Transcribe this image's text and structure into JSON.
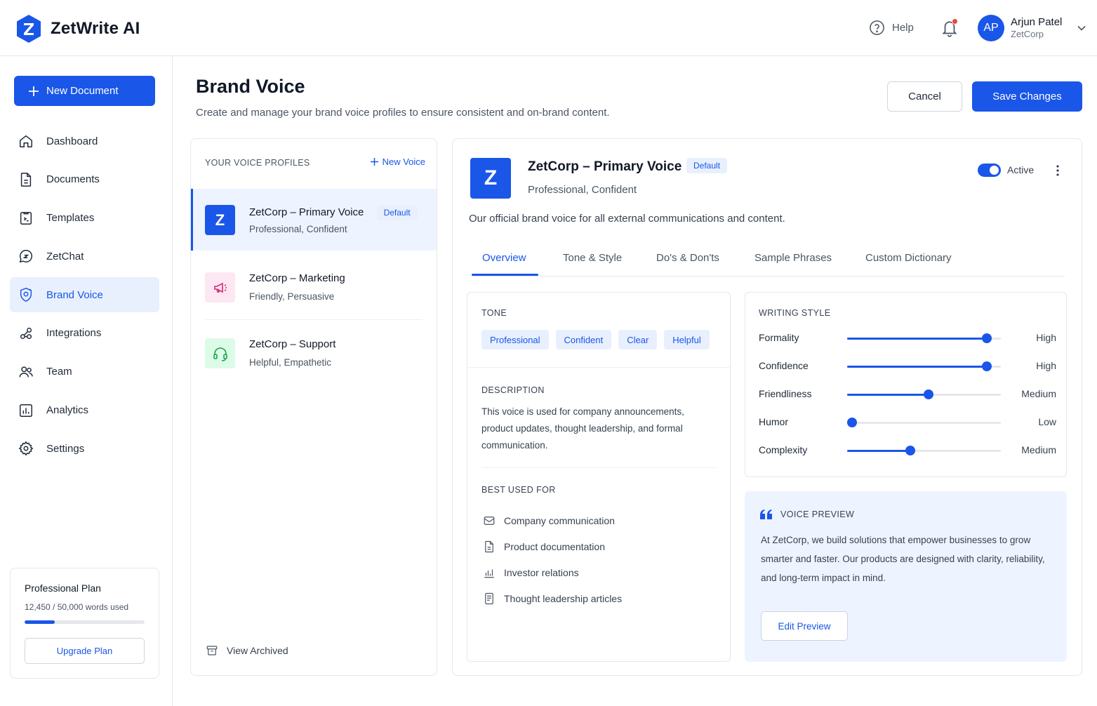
{
  "app": {
    "name": "ZetWrite AI",
    "logo_letter": "Z"
  },
  "header": {
    "help_label": "Help",
    "user": {
      "initials": "AP",
      "name": "Arjun Patel",
      "org": "ZetCorp"
    }
  },
  "sidebar": {
    "new_document_label": "New Document",
    "items": [
      {
        "label": "Dashboard",
        "icon": "home-icon"
      },
      {
        "label": "Documents",
        "icon": "document-icon"
      },
      {
        "label": "Templates",
        "icon": "template-icon"
      },
      {
        "label": "ZetChat",
        "icon": "chat-icon"
      },
      {
        "label": "Brand Voice",
        "icon": "brand-voice-icon",
        "active": true
      },
      {
        "label": "Integrations",
        "icon": "integrations-icon"
      },
      {
        "label": "Team",
        "icon": "team-icon"
      },
      {
        "label": "Analytics",
        "icon": "analytics-icon"
      },
      {
        "label": "Settings",
        "icon": "gear-icon"
      }
    ],
    "plan": {
      "title": "Professional Plan",
      "usage": "12,450 / 50,000 words used",
      "usage_fraction": 0.249,
      "upgrade_label": "Upgrade Plan"
    }
  },
  "page": {
    "title": "Brand Voice",
    "subtitle": "Create and manage your brand voice profiles to ensure consistent and on-brand content.",
    "cancel_label": "Cancel",
    "save_label": "Save Changes"
  },
  "profiles": {
    "heading": "YOUR VOICE PROFILES",
    "new_voice_label": "New Voice",
    "default_badge": "Default",
    "items": [
      {
        "name": "ZetCorp – Primary Voice",
        "traits": "Professional, Confident",
        "icon": "z-logo-icon",
        "default": true,
        "active": true
      },
      {
        "name": "ZetCorp – Marketing",
        "traits": "Friendly, Persuasive",
        "icon": "megaphone-icon"
      },
      {
        "name": "ZetCorp – Support",
        "traits": "Helpful, Empathetic",
        "icon": "headset-icon"
      }
    ],
    "view_archived_label": "View Archived"
  },
  "detail": {
    "icon_letter": "Z",
    "title": "ZetCorp – Primary Voice",
    "badge": "Default",
    "traits": "Professional, Confident",
    "active_label": "Active",
    "description": "Our official brand voice for all external communications and content.",
    "tabs": [
      "Overview",
      "Tone & Style",
      "Do's & Don'ts",
      "Sample Phrases",
      "Custom Dictionary"
    ],
    "tone": {
      "label": "TONE",
      "chips": [
        "Professional",
        "Confident",
        "Clear",
        "Helpful"
      ]
    },
    "description_section": {
      "label": "DESCRIPTION",
      "text": "This voice is used for company announcements, product updates, thought leadership, and formal communication."
    },
    "best_used_for": {
      "label": "BEST USED FOR",
      "items": [
        {
          "label": "Company communication",
          "icon": "mail-icon"
        },
        {
          "label": "Product documentation",
          "icon": "document-icon"
        },
        {
          "label": "Investor relations",
          "icon": "chart-icon"
        },
        {
          "label": "Thought leadership articles",
          "icon": "article-icon"
        }
      ]
    },
    "writing_style": {
      "label": "WRITING STYLE",
      "sliders": [
        {
          "label": "Formality",
          "value": 0.91,
          "level": "High"
        },
        {
          "label": "Confidence",
          "value": 0.91,
          "level": "High"
        },
        {
          "label": "Friendliness",
          "value": 0.53,
          "level": "Medium"
        },
        {
          "label": "Humor",
          "value": 0.03,
          "level": "Low"
        },
        {
          "label": "Complexity",
          "value": 0.41,
          "level": "Medium"
        }
      ]
    },
    "voice_preview": {
      "label": "VOICE PREVIEW",
      "text": "At ZetCorp, we build solutions that empower businesses to grow smarter and faster. Our products are designed with clarity, reliability, and long-term impact in mind.",
      "edit_label": "Edit Preview"
    }
  }
}
